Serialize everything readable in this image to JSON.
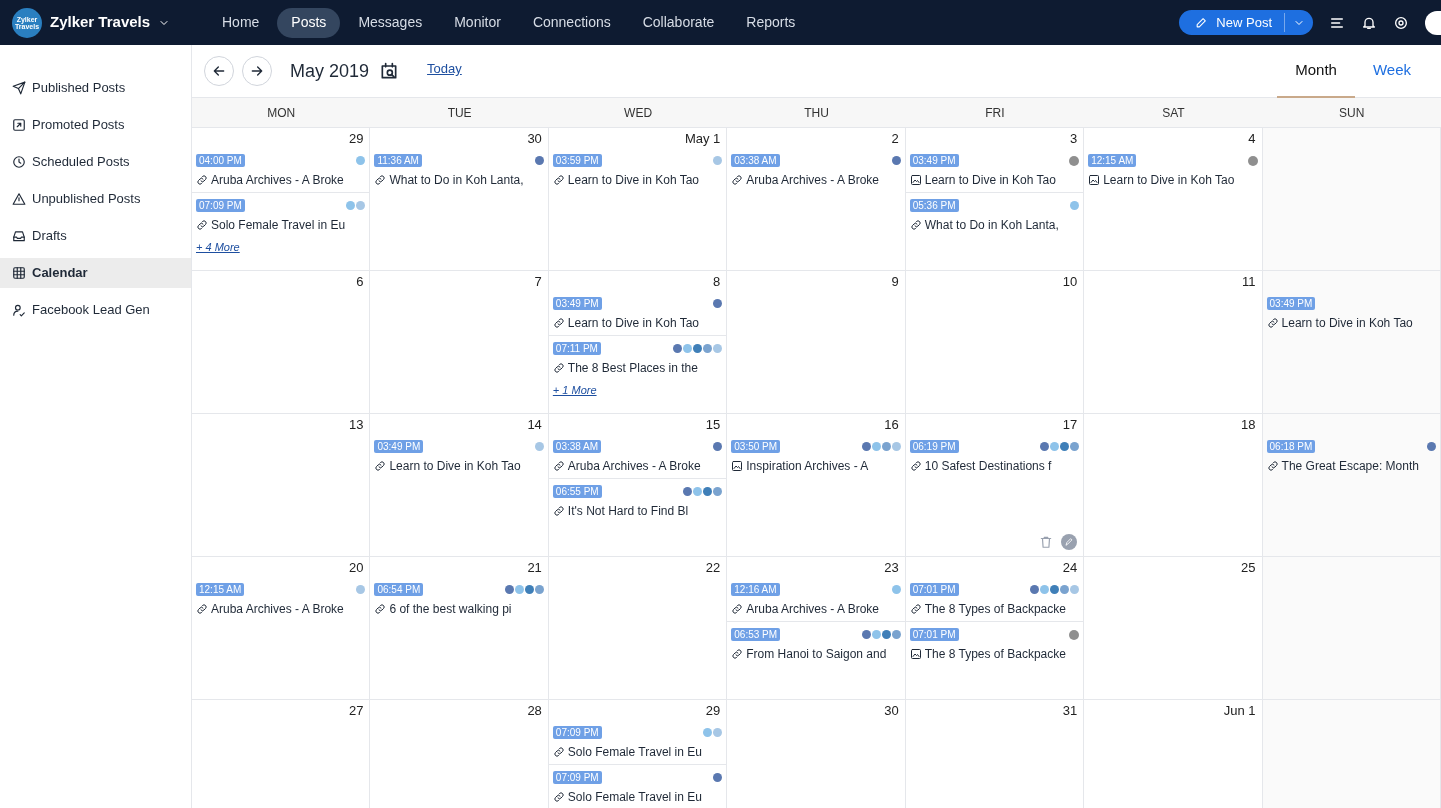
{
  "brand": {
    "name": "Zylker Travels",
    "logo_text": "Zylker Travels"
  },
  "nav": [
    {
      "label": "Home",
      "selected": false
    },
    {
      "label": "Posts",
      "selected": true
    },
    {
      "label": "Messages",
      "selected": false
    },
    {
      "label": "Monitor",
      "selected": false
    },
    {
      "label": "Connections",
      "selected": false
    },
    {
      "label": "Collaborate",
      "selected": false
    },
    {
      "label": "Reports",
      "selected": false
    }
  ],
  "new_post_button": "New Post",
  "sidebar": {
    "items": [
      {
        "label": "Published Posts",
        "kind": "send",
        "selected": false
      },
      {
        "label": "Promoted Posts",
        "kind": "promote",
        "selected": false
      },
      {
        "label": "Scheduled Posts",
        "kind": "clock",
        "selected": false
      },
      {
        "label": "Unpublished Posts",
        "kind": "warning",
        "selected": false
      },
      {
        "label": "Drafts",
        "kind": "drafts",
        "selected": false
      },
      {
        "label": "Calendar",
        "kind": "calendar",
        "selected": true
      },
      {
        "label": "Facebook Lead Gen",
        "kind": "lead",
        "selected": false
      }
    ]
  },
  "calendar": {
    "title": "May 2019",
    "today_link": "Today",
    "views": [
      {
        "label": "Month",
        "selected": true
      },
      {
        "label": "Week",
        "selected": false
      }
    ],
    "weekdays": [
      "MON",
      "TUE",
      "WED",
      "THU",
      "FRI",
      "SAT",
      "SUN"
    ],
    "weeks": [
      [
        {
          "label": "29",
          "posts": [
            {
              "time": "04:00 PM",
              "title": "Aruba Archives - A Broke",
              "kind": "link",
              "networks": [
                {
                  "kind": "twitter"
                }
              ]
            },
            {
              "time": "07:09 PM",
              "title": "Solo Female Travel in Eu",
              "kind": "link",
              "networks": [
                {
                  "kind": "twitter"
                },
                {
                  "kind": "google"
                }
              ]
            }
          ],
          "more": "+ 4 More"
        },
        {
          "label": "30",
          "posts": [
            {
              "time": "11:36 AM",
              "title": "What to Do in Koh Lanta,",
              "kind": "link",
              "networks": [
                {
                  "kind": "facebook"
                }
              ]
            }
          ]
        },
        {
          "label": "May 1",
          "posts": [
            {
              "time": "03:59 PM",
              "title": "Learn to Dive in Koh Tao",
              "kind": "link",
              "networks": [
                {
                  "kind": "google"
                }
              ]
            }
          ]
        },
        {
          "label": "2",
          "posts": [
            {
              "time": "03:38 AM",
              "title": "Aruba Archives - A Broke",
              "kind": "link",
              "networks": [
                {
                  "kind": "facebook"
                }
              ]
            }
          ]
        },
        {
          "label": "3",
          "posts": [
            {
              "time": "03:49 PM",
              "title": "Learn to Dive in Koh Tao",
              "kind": "image",
              "networks": [
                {
                  "kind": "pending"
                }
              ]
            },
            {
              "time": "05:36 PM",
              "title": "What to Do in Koh Lanta,",
              "kind": "link",
              "networks": [
                {
                  "kind": "twitter"
                }
              ]
            }
          ]
        },
        {
          "label": "4",
          "posts": [
            {
              "time": "12:15 AM",
              "title": "Learn to Dive in Koh Tao",
              "kind": "image",
              "networks": [
                {
                  "kind": "pending"
                }
              ]
            }
          ]
        }
      ],
      [
        {
          "label": "6"
        },
        {
          "label": "7"
        },
        {
          "label": "8",
          "posts": [
            {
              "time": "03:49 PM",
              "title": "Learn to Dive in Koh Tao",
              "kind": "link",
              "networks": [
                {
                  "kind": "facebook"
                }
              ]
            },
            {
              "time": "07:11 PM",
              "title": "The 8 Best Places in the",
              "kind": "link",
              "networks": [
                {
                  "kind": "facebook"
                },
                {
                  "kind": "twitter"
                },
                {
                  "kind": "linkedin"
                },
                {
                  "kind": "other"
                },
                {
                  "kind": "google"
                }
              ]
            }
          ],
          "more": "+ 1 More"
        },
        {
          "label": "9"
        },
        {
          "label": "10"
        },
        {
          "label": "11"
        },
        {
          "posts": [
            {
              "time": "03:49 PM",
              "title": "Learn to Dive in Koh Tao",
              "kind": "link"
            }
          ]
        }
      ],
      [
        {
          "label": "13"
        },
        {
          "label": "14",
          "posts": [
            {
              "time": "03:49 PM",
              "title": "Learn to Dive in Koh Tao",
              "kind": "link",
              "networks": [
                {
                  "kind": "google"
                }
              ]
            }
          ]
        },
        {
          "label": "15",
          "posts": [
            {
              "time": "03:38 AM",
              "title": "Aruba Archives - A Broke",
              "kind": "link",
              "networks": [
                {
                  "kind": "facebook"
                }
              ]
            },
            {
              "time": "06:55 PM",
              "title": "It's Not Hard to Find Bl",
              "kind": "link",
              "networks": [
                {
                  "kind": "facebook"
                },
                {
                  "kind": "twitter"
                },
                {
                  "kind": "linkedin"
                },
                {
                  "kind": "other"
                }
              ]
            }
          ]
        },
        {
          "label": "16",
          "posts": [
            {
              "time": "03:50 PM",
              "title": "Inspiration Archives - A",
              "kind": "image",
              "networks": [
                {
                  "kind": "facebook"
                },
                {
                  "kind": "twitter"
                },
                {
                  "kind": "other"
                },
                {
                  "kind": "google"
                }
              ]
            }
          ]
        },
        {
          "label": "17",
          "hovered": true,
          "posts": [
            {
              "time": "06:19 PM",
              "title": "10 Safest Destinations f",
              "kind": "link",
              "networks": [
                {
                  "kind": "facebook"
                },
                {
                  "kind": "twitter"
                },
                {
                  "kind": "linkedin"
                },
                {
                  "kind": "other"
                }
              ]
            }
          ]
        },
        {
          "label": "18"
        },
        {
          "posts": [
            {
              "time": "06:18 PM",
              "title": "The Great Escape: Month",
              "kind": "link",
              "networks": [
                {
                  "kind": "facebook"
                }
              ]
            }
          ]
        }
      ],
      [
        {
          "label": "20",
          "posts": [
            {
              "time": "12:15 AM",
              "title": "Aruba Archives - A Broke",
              "kind": "link",
              "networks": [
                {
                  "kind": "google"
                }
              ]
            }
          ]
        },
        {
          "label": "21",
          "posts": [
            {
              "time": "06:54 PM",
              "title": "6 of the best walking pi",
              "kind": "link",
              "networks": [
                {
                  "kind": "facebook"
                },
                {
                  "kind": "twitter"
                },
                {
                  "kind": "linkedin"
                },
                {
                  "kind": "other"
                }
              ]
            }
          ]
        },
        {
          "label": "22"
        },
        {
          "label": "23",
          "posts": [
            {
              "time": "12:16 AM",
              "title": "Aruba Archives - A Broke",
              "kind": "link",
              "networks": [
                {
                  "kind": "twitter"
                }
              ]
            },
            {
              "time": "06:53 PM",
              "title": "From Hanoi to Saigon and",
              "kind": "link",
              "networks": [
                {
                  "kind": "facebook"
                },
                {
                  "kind": "twitter"
                },
                {
                  "kind": "linkedin"
                },
                {
                  "kind": "other"
                }
              ]
            }
          ]
        },
        {
          "label": "24",
          "posts": [
            {
              "time": "07:01 PM",
              "title": "The 8 Types of Backpacke",
              "kind": "link",
              "networks": [
                {
                  "kind": "facebook"
                },
                {
                  "kind": "twitter"
                },
                {
                  "kind": "linkedin"
                },
                {
                  "kind": "other"
                },
                {
                  "kind": "google"
                }
              ]
            },
            {
              "time": "07:01 PM",
              "title": "The 8 Types of Backpacke",
              "kind": "image",
              "networks": [
                {
                  "kind": "pending"
                }
              ]
            }
          ]
        },
        {
          "label": "25"
        }
      ],
      [
        {
          "label": "27"
        },
        {
          "label": "28"
        },
        {
          "label": "29",
          "posts": [
            {
              "time": "07:09 PM",
              "title": "Solo Female Travel in Eu",
              "kind": "link",
              "networks": [
                {
                  "kind": "twitter"
                },
                {
                  "kind": "google"
                }
              ]
            },
            {
              "time": "07:09 PM",
              "title": "Solo Female Travel in Eu",
              "kind": "link",
              "networks": [
                {
                  "kind": "facebook"
                }
              ]
            }
          ]
        },
        {
          "label": "30"
        },
        {
          "label": "31"
        },
        {
          "label": "Jun 1"
        }
      ]
    ]
  }
}
